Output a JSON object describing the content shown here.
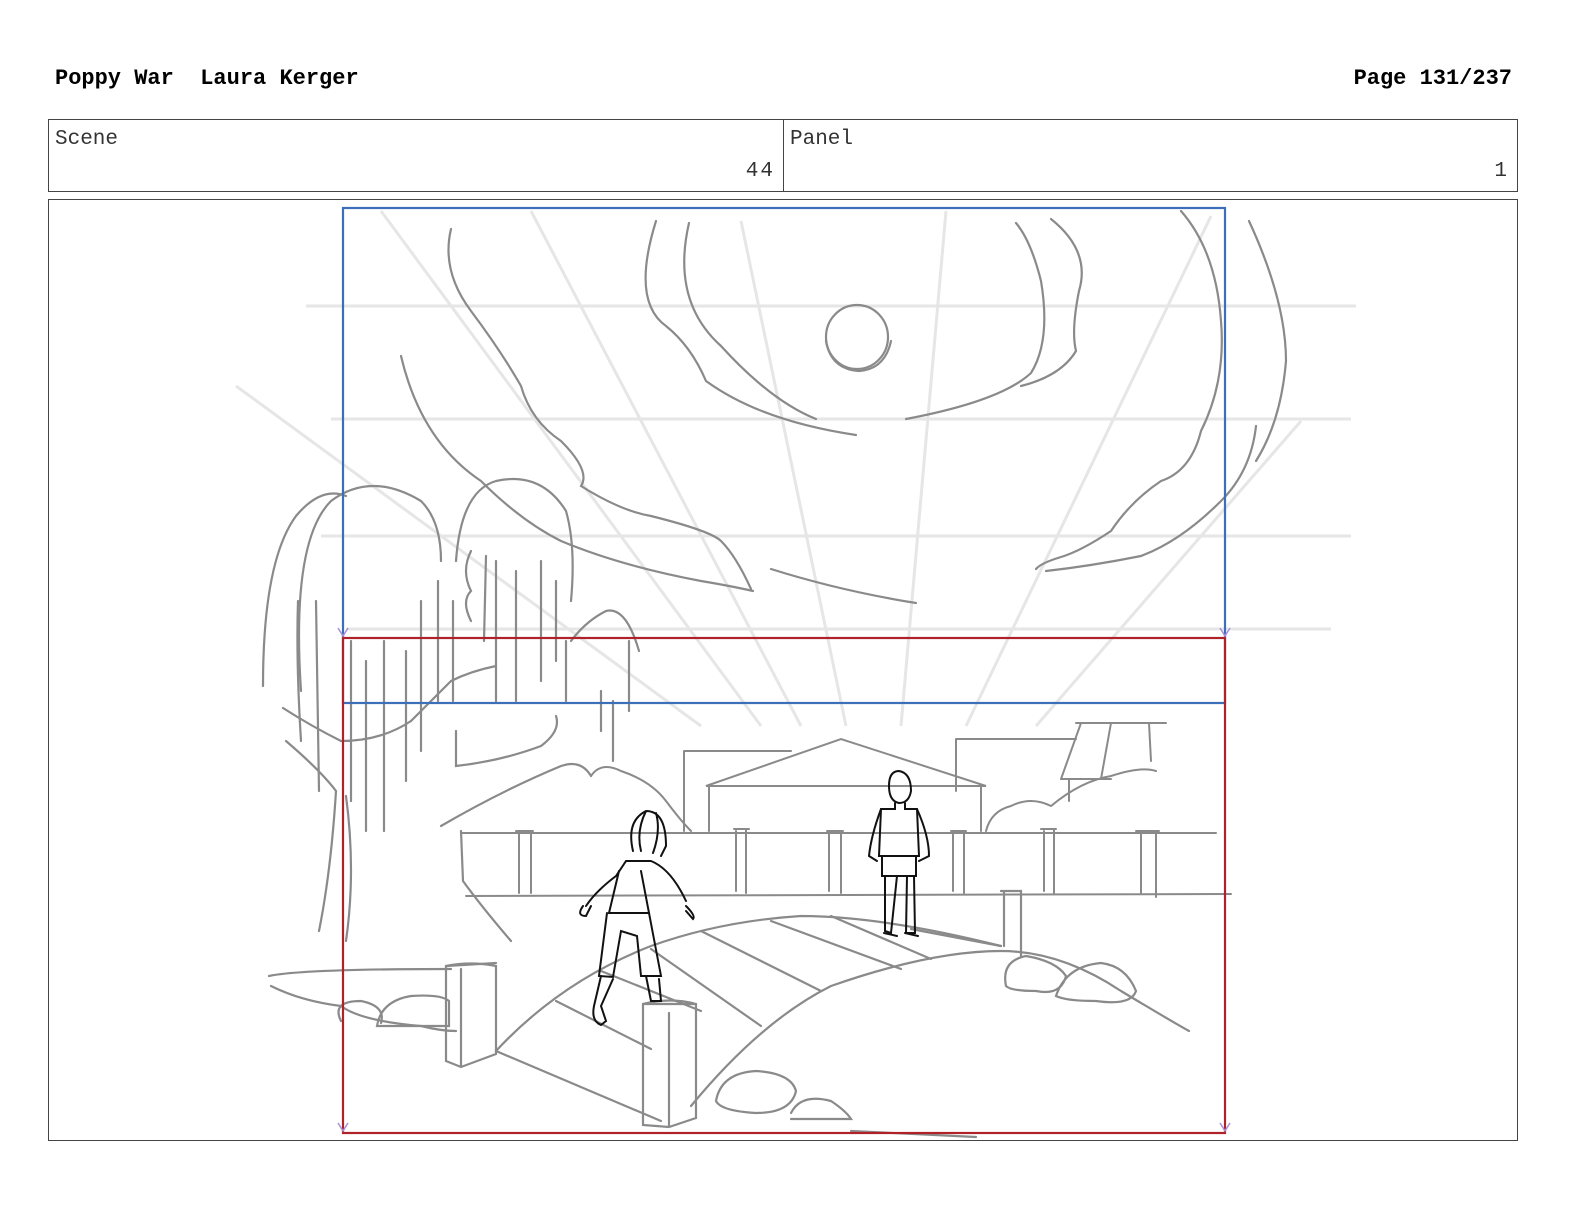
{
  "header": {
    "project": "Poppy War",
    "author": "Laura Kerger",
    "page": "Page 131/237"
  },
  "scene": {
    "label": "Scene",
    "value": "44"
  },
  "panel": {
    "label": "Panel",
    "value": "1"
  },
  "colors": {
    "camera_start": "#3b6fba",
    "camera_end": "#b0222a",
    "sketch": "#8a8a8a",
    "guide": "#e6e6e6",
    "characters": "#111111"
  }
}
